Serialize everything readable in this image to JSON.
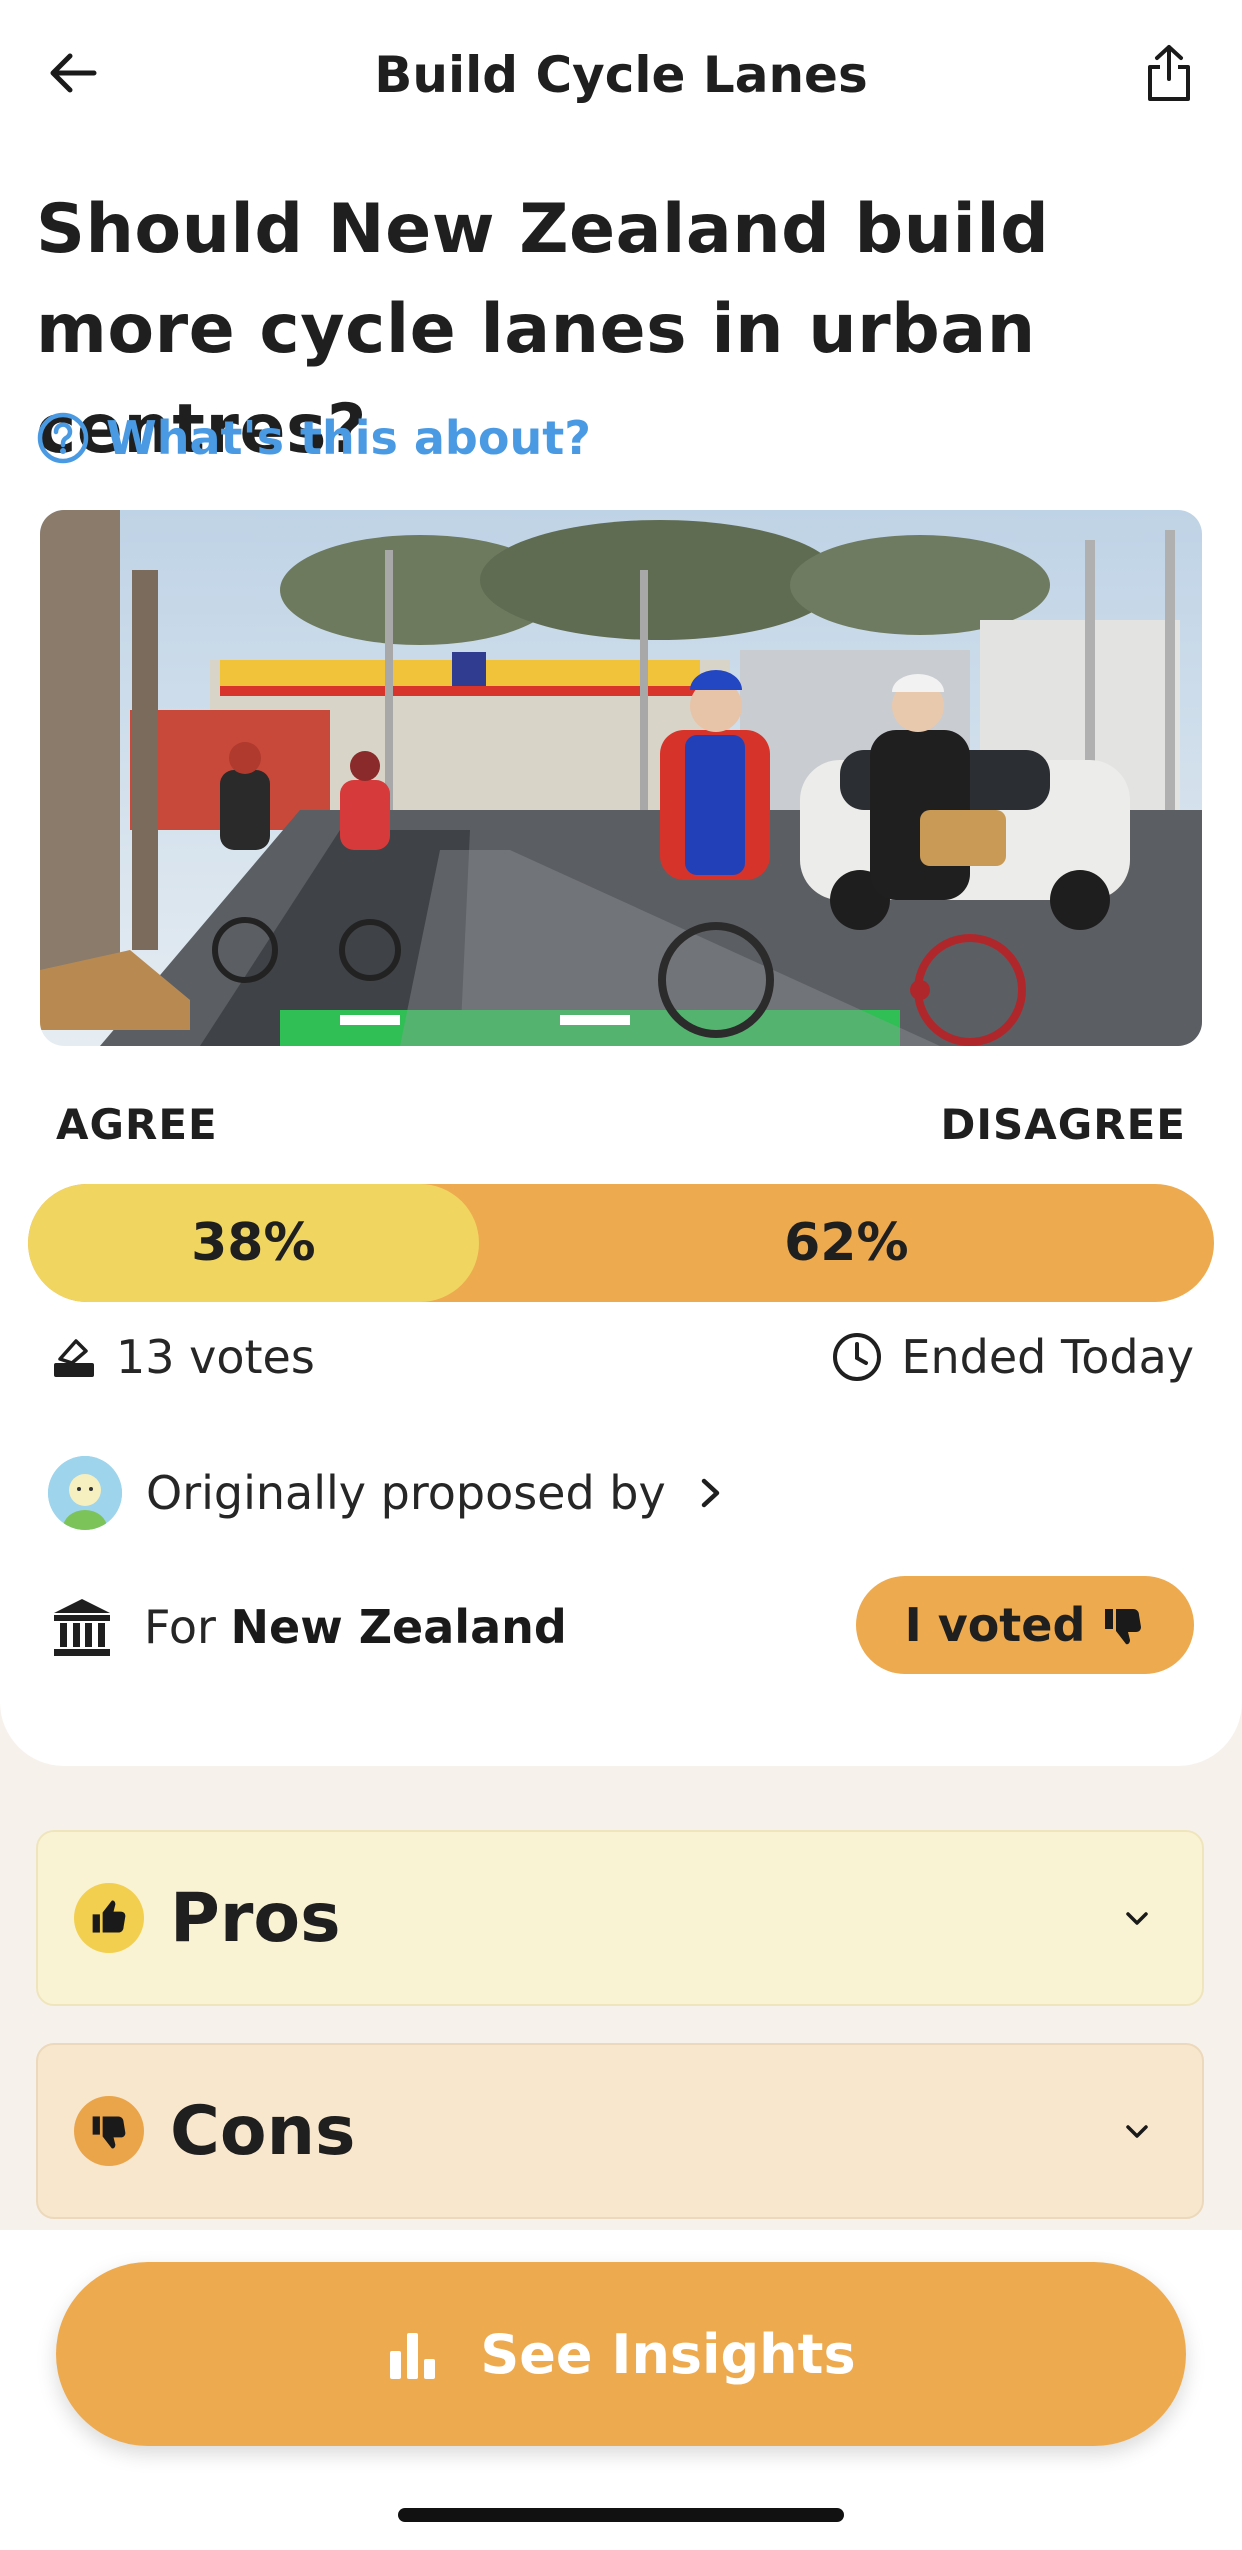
{
  "header": {
    "title": "Build Cycle Lanes"
  },
  "question": "Should New Zealand build more cycle lanes in urban centres?",
  "about_link": "What's this about?",
  "image": {
    "description_icon": "photo"
  },
  "vote": {
    "agree_label": "AGREE",
    "disagree_label": "DISAGREE",
    "agree_percent": 38,
    "disagree_percent": 62,
    "agree_text": "38%",
    "disagree_text": "62%"
  },
  "meta": {
    "votes": "13 votes",
    "status": "Ended Today"
  },
  "proposer": {
    "label": "Originally proposed by"
  },
  "jurisdiction": {
    "prefix": "For",
    "name": "New Zealand"
  },
  "voted_button": "I voted",
  "sections": {
    "pros": "Pros",
    "cons": "Cons"
  },
  "insights_button": "See Insights",
  "colors": {
    "accent": "#edaa4f",
    "agree": "#f0d561",
    "link": "#4a9ae3"
  }
}
